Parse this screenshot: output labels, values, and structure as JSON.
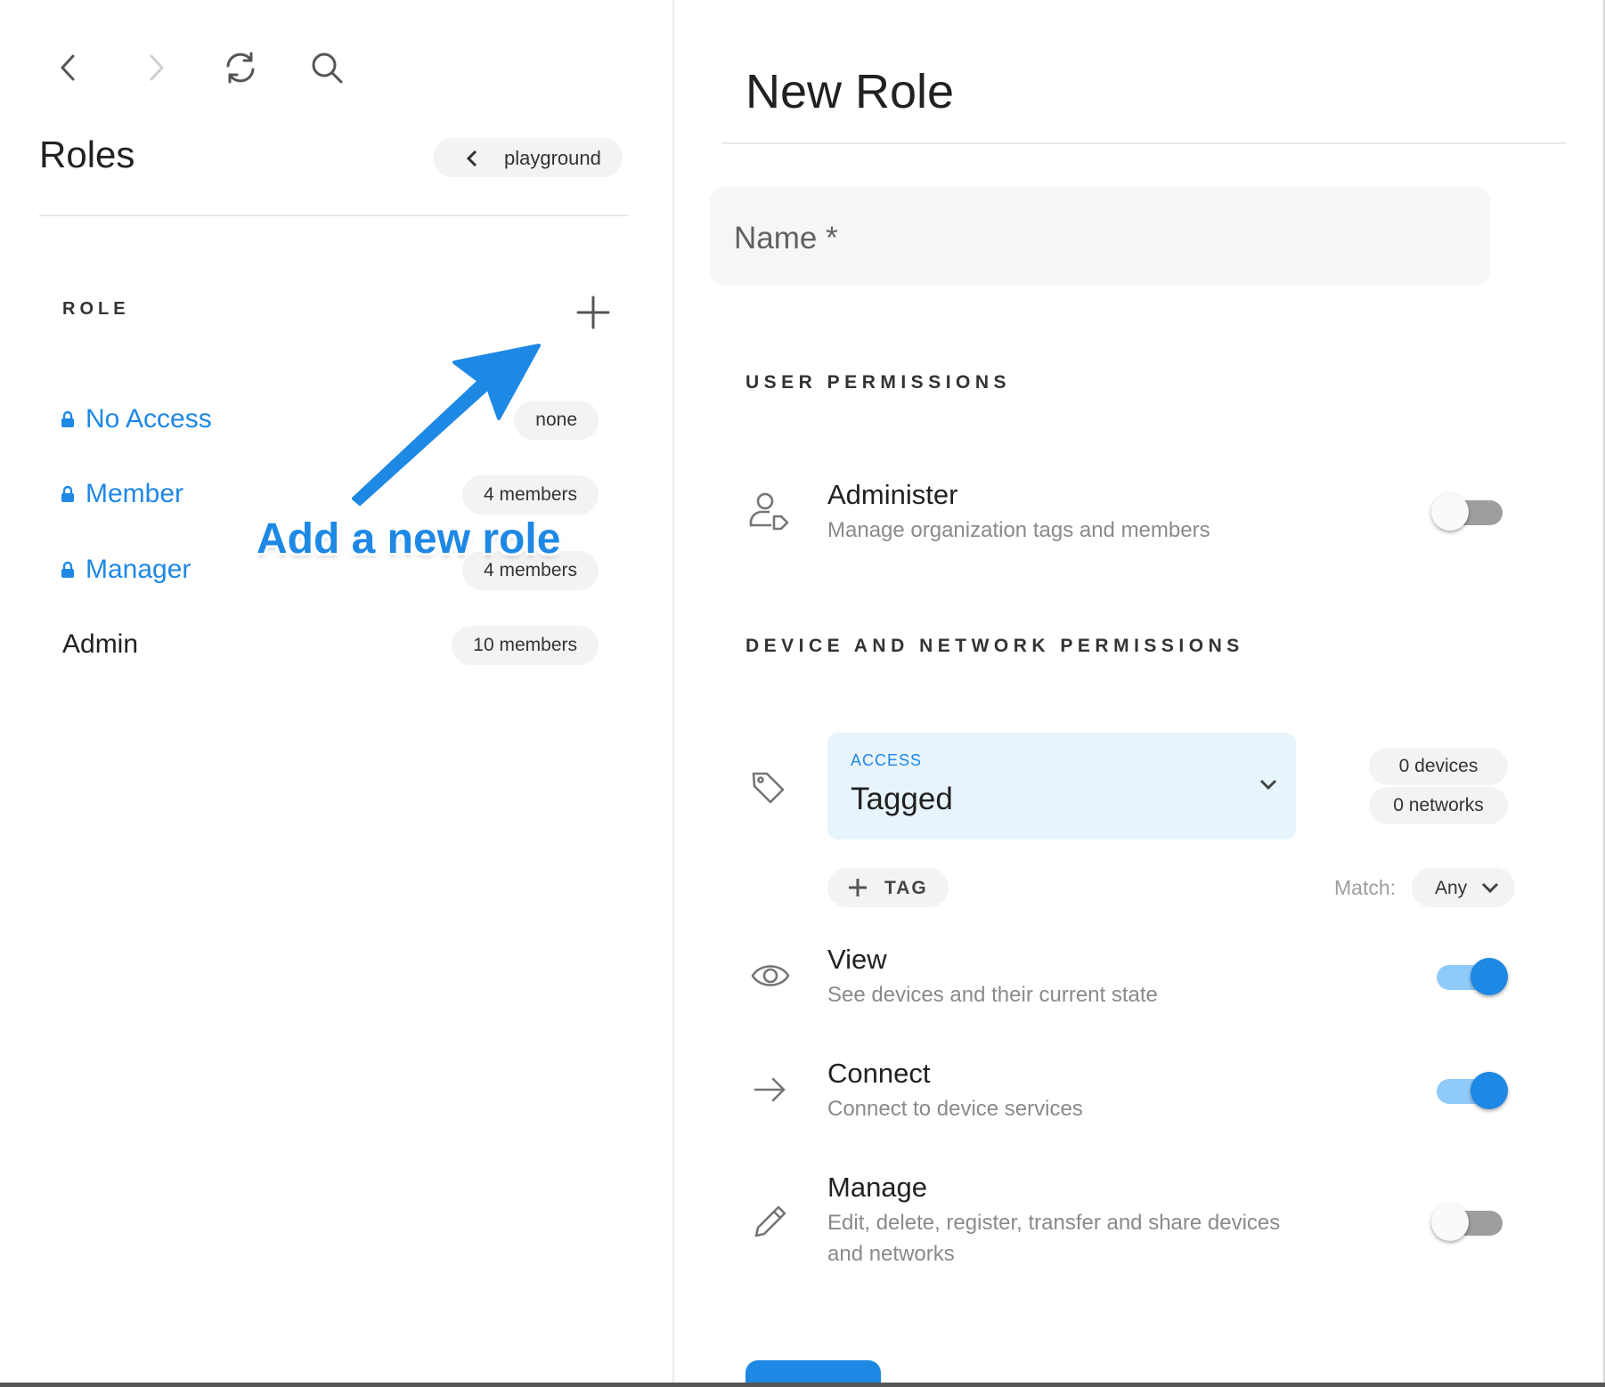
{
  "navigation": {
    "back_icon": "chevron-left-icon",
    "forward_icon": "chevron-right-icon",
    "refresh_icon": "refresh-icon",
    "search_icon": "search-icon"
  },
  "left_panel": {
    "title": "Roles",
    "org_pill": "playground",
    "section_header": "ROLE",
    "add_icon": "plus-icon",
    "roles": [
      {
        "name": "No Access",
        "count": "none",
        "locked": true
      },
      {
        "name": "Member",
        "count": "4 members",
        "locked": true
      },
      {
        "name": "Manager",
        "count": "4 members",
        "locked": true
      },
      {
        "name": "Admin",
        "count": "10 members",
        "locked": false
      }
    ]
  },
  "annotation": {
    "text": "Add a new role"
  },
  "form": {
    "title": "New Role",
    "name_label": "Name *",
    "user_permissions_heading": "USER PERMISSIONS",
    "administer": {
      "title": "Administer",
      "description": "Manage organization tags and members",
      "enabled": false,
      "icon": "user-tag-icon"
    },
    "device_permissions_heading": "DEVICE AND NETWORK PERMISSIONS",
    "access": {
      "label": "ACCESS",
      "value": "Tagged",
      "icon": "tag-icon"
    },
    "devices_count": "0 devices",
    "networks_count": "0 networks",
    "add_tag_label": "TAG",
    "match_label": "Match:",
    "match_value": "Any",
    "view": {
      "title": "View",
      "description": "See devices and their current state",
      "enabled": true,
      "icon": "eye-icon"
    },
    "connect": {
      "title": "Connect",
      "description": "Connect to device services",
      "enabled": true,
      "icon": "arrow-right-icon"
    },
    "manage": {
      "title": "Manage",
      "description": "Edit, delete, register, transfer and share devices and networks",
      "enabled": false,
      "icon": "pencil-icon"
    }
  },
  "colors": {
    "accent": "#1e88e5",
    "accent_light": "#90caf9",
    "select_bg": "#e8f4fc",
    "pill_bg": "#f3f3f3"
  }
}
